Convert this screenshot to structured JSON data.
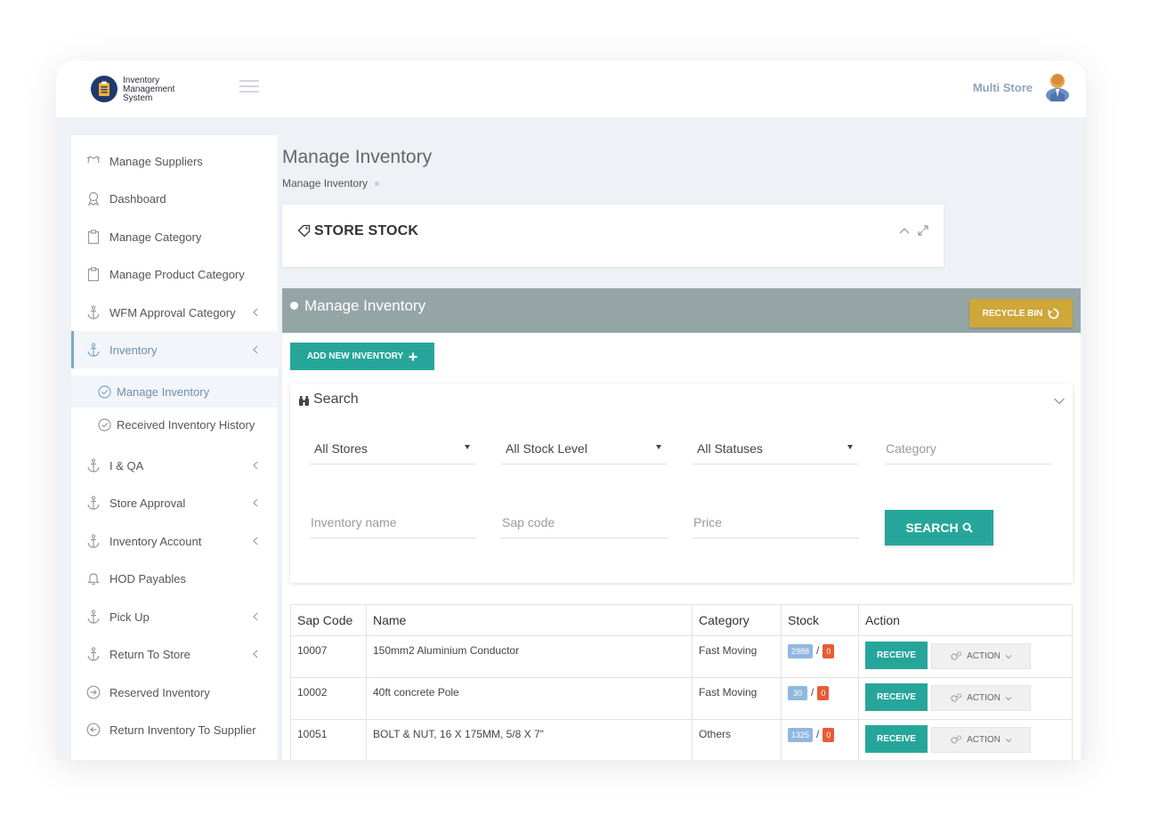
{
  "header": {
    "logo_lines": [
      "Inventory",
      "Management",
      "System"
    ],
    "user_name": "Multi Store"
  },
  "sidebar": {
    "items": [
      {
        "label": "Manage Suppliers",
        "icon": "suppliers-icon"
      },
      {
        "label": "Dashboard",
        "icon": "dashboard-icon"
      },
      {
        "label": "Manage Category",
        "icon": "clipboard-icon"
      },
      {
        "label": "Manage Product Category",
        "icon": "clipboard-icon"
      },
      {
        "label": "WFM Approval Category",
        "icon": "anchor-icon"
      },
      {
        "label": "Inventory",
        "icon": "anchor-icon"
      },
      {
        "label": "I & QA",
        "icon": "anchor-icon"
      },
      {
        "label": "Store Approval",
        "icon": "anchor-icon"
      },
      {
        "label": "Inventory Account",
        "icon": "anchor-icon"
      },
      {
        "label": "HOD Payables",
        "icon": "bell-icon"
      },
      {
        "label": "Pick Up",
        "icon": "anchor-icon"
      },
      {
        "label": "Return To Store",
        "icon": "anchor-icon"
      },
      {
        "label": "Reserved Inventory",
        "icon": "arrow-right-circle-icon"
      },
      {
        "label": "Return Inventory To Supplier",
        "icon": "arrow-left-circle-icon"
      }
    ],
    "sub_items": [
      {
        "label": "Manage Inventory"
      },
      {
        "label": "Received Inventory History"
      }
    ]
  },
  "page": {
    "title": "Manage Inventory",
    "breadcrumb": "Manage Inventory"
  },
  "store_stock": {
    "title": "STORE STOCK"
  },
  "panel": {
    "title": "Manage Inventory",
    "recycle_label": "RECYCLE BIN",
    "add_label": "ADD NEW INVENTORY"
  },
  "search": {
    "title": "Search",
    "store_select": "All Stores",
    "stock_select": "All Stock Level",
    "status_select": "All Statuses",
    "category_placeholder": "Category",
    "name_placeholder": "Inventory name",
    "sap_placeholder": "Sap code",
    "price_placeholder": "Price",
    "button_label": "SEARCH"
  },
  "table": {
    "headers": [
      "Sap Code",
      "Name",
      "Category",
      "Stock",
      "Action"
    ],
    "rows": [
      {
        "sap": "10007",
        "name": "150mm2 Aluminium Conductor",
        "category": "Fast Moving",
        "stock": "2988",
        "reserved": "0"
      },
      {
        "sap": "10002",
        "name": "40ft concrete Pole",
        "category": "Fast Moving",
        "stock": "30",
        "reserved": "0"
      },
      {
        "sap": "10051",
        "name": "BOLT & NUT, 16 X 175MM, 5/8 X 7\"",
        "category": "Others",
        "stock": "1325",
        "reserved": "0"
      }
    ],
    "receive_label": "RECEIVE",
    "action_label": "ACTION"
  },
  "colors": {
    "teal": "#26a69a",
    "gold": "#cfa73a",
    "panel_gray": "#95a5a6",
    "badge_blue": "#8fb8de",
    "badge_red": "#e95a36",
    "logo_navy": "#1f3a6e"
  }
}
